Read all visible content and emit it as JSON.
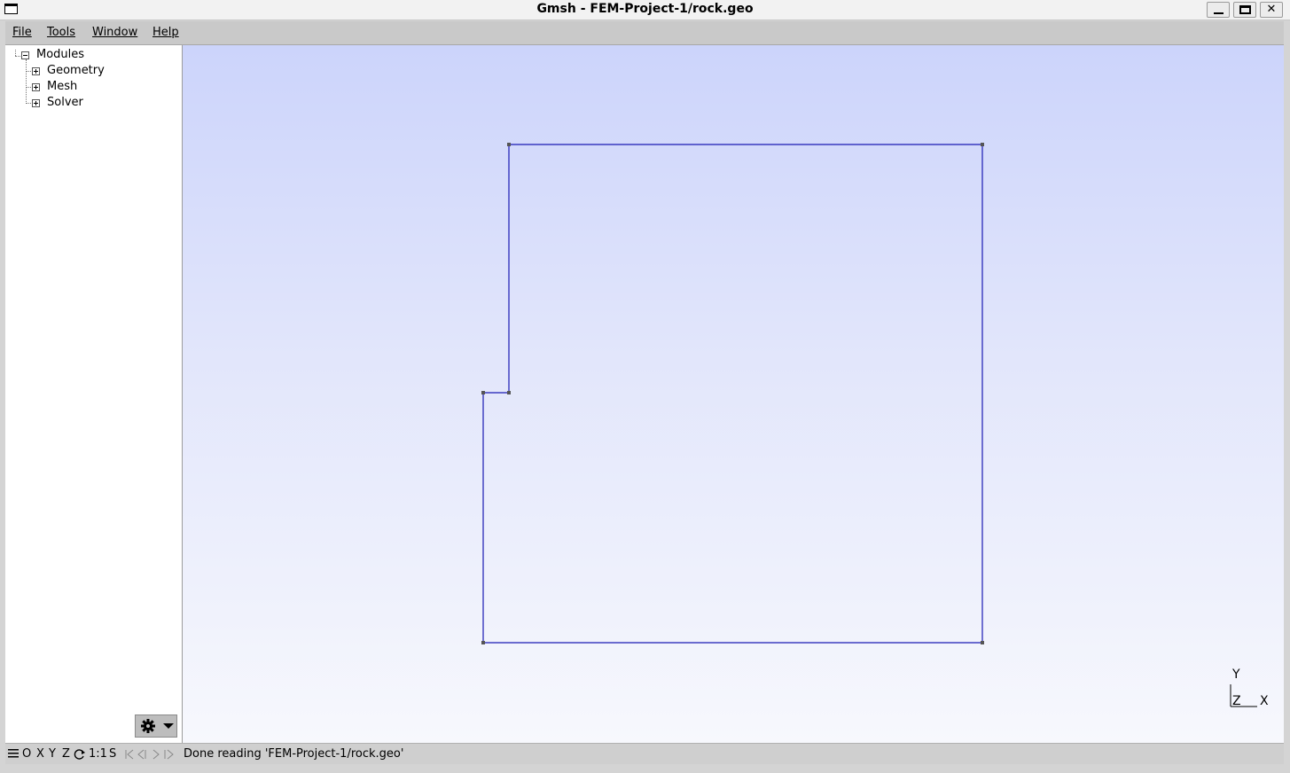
{
  "window": {
    "title": "Gmsh - FEM-Project-1/rock.geo",
    "controls": {
      "minimize": "minimize",
      "maximize": "maximize",
      "close": "✕"
    }
  },
  "menubar": {
    "items": [
      {
        "label": "File"
      },
      {
        "label": "Tools"
      },
      {
        "label": "Window"
      },
      {
        "label": "Help"
      }
    ]
  },
  "tree": {
    "root": {
      "label": "Modules",
      "expanded": true
    },
    "children": [
      {
        "label": "Geometry",
        "expanded": false
      },
      {
        "label": "Mesh",
        "expanded": false
      },
      {
        "label": "Solver",
        "expanded": false
      }
    ]
  },
  "viewport": {
    "axes": {
      "y": "Y",
      "z": "Z",
      "x": "X"
    },
    "colors": {
      "geometry_line": "#1a1ab4",
      "point": "#555555"
    }
  },
  "statusbar": {
    "view_buttons": [
      "O",
      "X",
      "Y",
      "Z"
    ],
    "scale": "1:1",
    "snap": "S",
    "message": "Done reading 'FEM-Project-1/rock.geo'"
  }
}
